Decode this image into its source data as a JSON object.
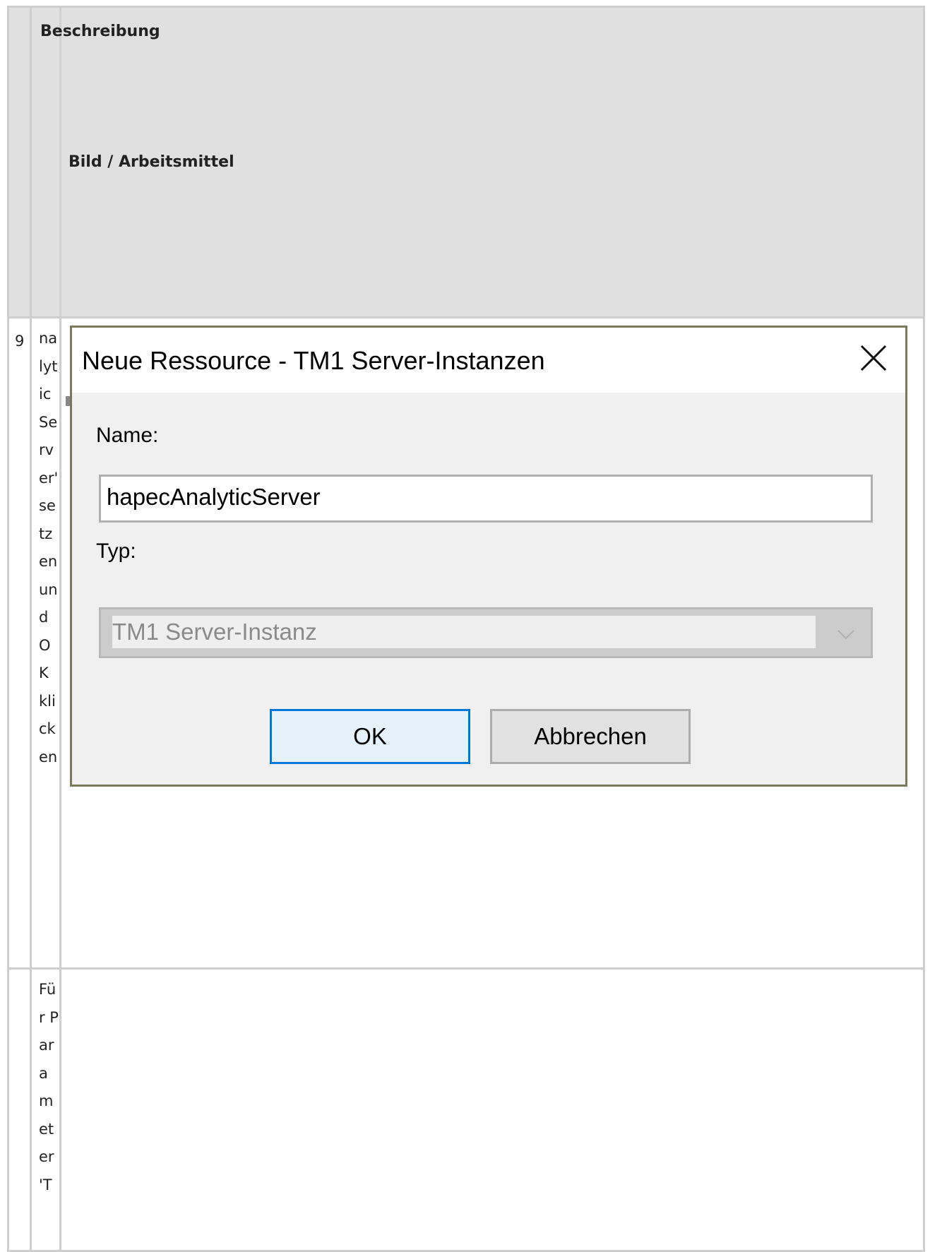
{
  "table": {
    "header_desc": "Beschreibung",
    "header_title": "Bild / Arbeitsmittel",
    "rows": [
      {
        "num": "9",
        "desc": "nalyticServer' setzen und OK klicken"
      },
      {
        "num": "",
        "desc": "Für Parameter 'T"
      }
    ]
  },
  "dialog": {
    "title": "Neue Ressource - TM1 Server-Instanzen",
    "name_label": "Name:",
    "name_value": "hapecAnalyticServer",
    "type_label": "Typ:",
    "type_value": "TM1 Server-Instanz",
    "ok_label": "OK",
    "cancel_label": "Abbrechen",
    "accent_color": "#0078d7"
  }
}
